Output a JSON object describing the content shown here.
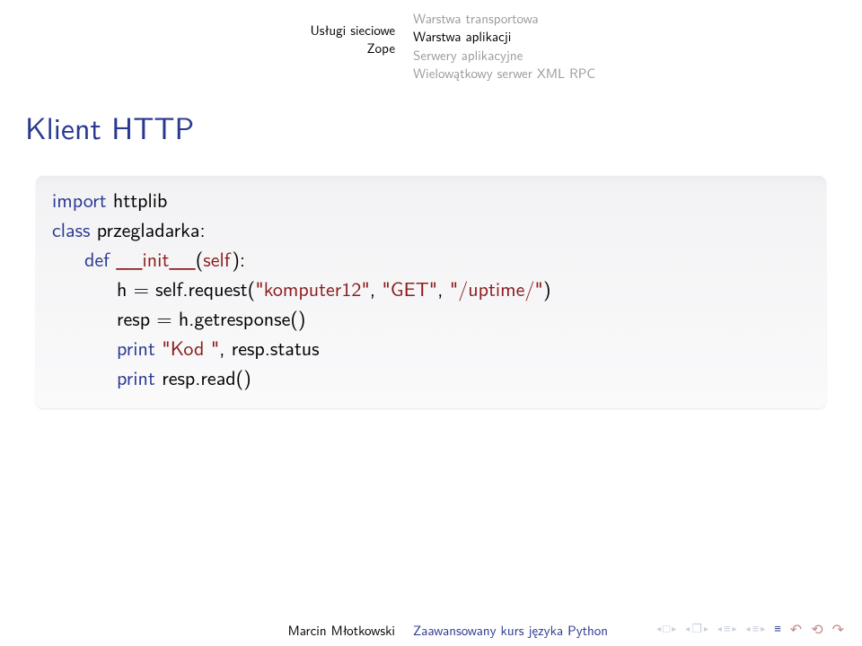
{
  "header": {
    "left": {
      "section": "Usługi sieciowe",
      "subsection": "Zope"
    },
    "right": {
      "l1": "Warstwa transportowa",
      "l2": "Warstwa aplikacji",
      "l3": "Serwery aplikacyjne",
      "l4": "Wielowątkowy serwer XML RPC"
    }
  },
  "frametitle": "Klient HTTP",
  "code": {
    "l1a": "import ",
    "l1b": "httplib",
    "l2a": "class ",
    "l2b": "przegladarka:",
    "l3a": "def ",
    "l3b": "__init__",
    "l3c": "(",
    "l3d": "self",
    "l3e": "):",
    "l4a": "h = self.request(",
    "l4b": "\"komputer12\"",
    "l4c": ", ",
    "l4d": "\"GET\"",
    "l4e": ", ",
    "l4f": "\"/uptime/\"",
    "l4g": ")",
    "l5": "resp = h.getresponse()",
    "l6a": "print ",
    "l6b": "\"Kod \"",
    "l6c": ", resp.status",
    "l7a": "print ",
    "l7b": "resp.read()"
  },
  "footer": {
    "author": "Marcin Młotkowski",
    "title": "Zaawansowany kurs języka Python"
  },
  "nav": {
    "box": "□",
    "tri": "▸",
    "doc": "❐",
    "bars": "≡",
    "bigtri": "≡",
    "compass1": "↶",
    "compass2": "⟲",
    "compass3": "↷"
  }
}
